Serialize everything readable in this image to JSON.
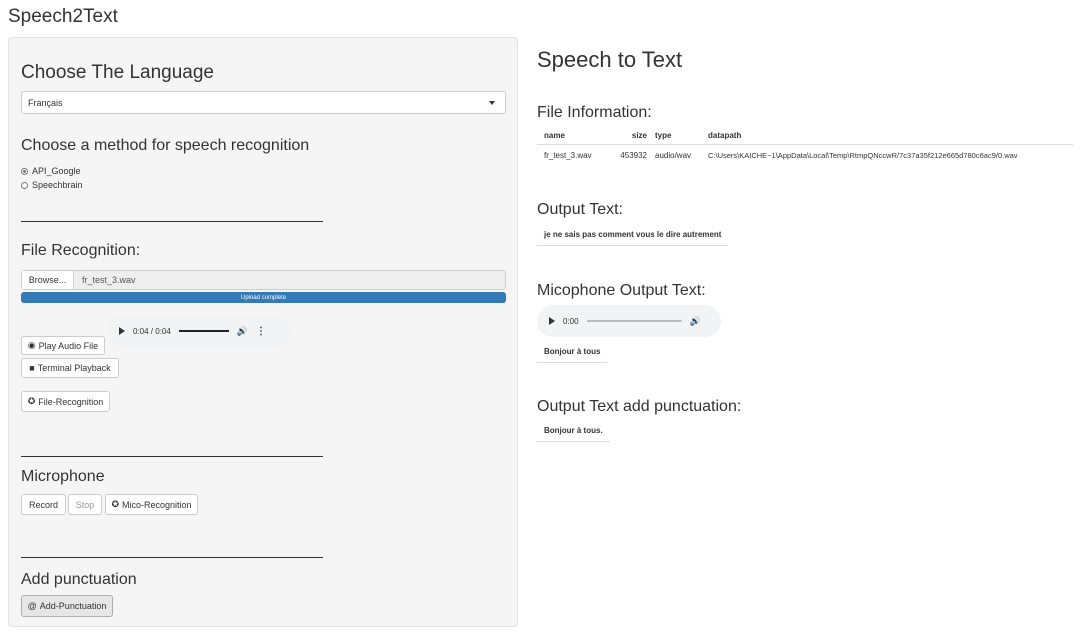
{
  "app_title": "Speech2Text",
  "sidebar": {
    "language_heading": "Choose The Language",
    "language_select": {
      "value": "Français"
    },
    "method_heading": "Choose a method for speech recognition",
    "methods": [
      {
        "label": "API_Google",
        "selected": true
      },
      {
        "label": "Speechbrain",
        "selected": false
      }
    ],
    "file_heading": "File Recognition:",
    "file_input": {
      "browse_label": "Browse...",
      "filename": "fr_test_3.wav"
    },
    "upload_status": "Upload complete",
    "file_audio": {
      "time": "0:04 / 0:04",
      "progress": 1.0,
      "volume_icon": "volume-icon",
      "more_icon": "more-vert-icon"
    },
    "play_audio_label": "Play Audio File",
    "terminal_playback_label": "Terminal Playback",
    "file_recognition_label": "File-Recognition",
    "microphone_heading": "Microphone",
    "record_label": "Record",
    "stop_label": "Stop",
    "mico_recognition_label": "Mico-Recognition",
    "punctuation_heading": "Add punctuation",
    "add_punctuation_label": "Add-Punctuation"
  },
  "main": {
    "title": "Speech to Text",
    "file_info_heading": "File Information:",
    "file_table": {
      "headers": [
        "name",
        "size",
        "type",
        "datapath"
      ],
      "rows": [
        [
          "fr_test_3.wav",
          "453932",
          "audio/wav",
          "C:\\Users\\KAICHE~1\\AppData\\Local\\Temp\\RtmpQNccwR/7c37a35f212e665d780c6ac9/0.wav"
        ]
      ]
    },
    "output_heading": "Output Text:",
    "output_text": "je ne sais pas comment vous le dire autrement",
    "mic_output_heading": "Micophone Output Text:",
    "mic_audio": {
      "time": "0:00",
      "progress": 0.0
    },
    "mic_output_text": "Bonjour à tous",
    "punct_heading": "Output Text add punctuation:",
    "punct_text": "Bonjour à tous."
  },
  "colors": {
    "accent": "#337ab7",
    "sidebar_bg": "#f5f5f5"
  }
}
